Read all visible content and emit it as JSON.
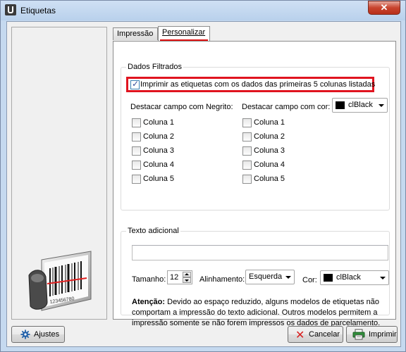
{
  "window": {
    "title": "Etiquetas",
    "close_glyph": "✕"
  },
  "tabs": [
    {
      "label": "Impressão"
    },
    {
      "label": "Personalizar"
    }
  ],
  "filtered": {
    "group_label": "Dados Filtrados",
    "print_checkbox_label": "Imprimir as etiquetas com os dados das primeiras 5 colunas listadas",
    "print_checked": true,
    "bold_heading": "Destacar campo com Negrito:",
    "color_heading": "Destacar campo com cor:",
    "color_value": "clBlack",
    "bold_columns": [
      "Coluna 1",
      "Coluna 2",
      "Coluna 3",
      "Coluna 4",
      "Coluna 5"
    ],
    "color_columns": [
      "Coluna 1",
      "Coluna 2",
      "Coluna 3",
      "Coluna 4",
      "Coluna 5"
    ]
  },
  "extra": {
    "group_label": "Texto adicional",
    "text_value": "",
    "size_label": "Tamanho:",
    "size_value": "12",
    "align_label": "Alinhamento:",
    "align_value": "Esquerda",
    "color_label": "Cor:",
    "color_value": "clBlack",
    "note_bold": "Atenção:",
    "note_text": " Devido ao espaço reduzido, alguns modelos de etiquetas não comportam a impressão do texto adicional. Outros modelos permitem a impressão somente se não forem impressos os dados de parcelamento."
  },
  "buttons": {
    "settings": "Ajustes",
    "cancel": "Cancelar",
    "print": "Imprimir"
  },
  "barcode_text": "123456780",
  "icons": [
    "app-icon",
    "close-icon",
    "barcode-scanner-icon",
    "gear-icon",
    "cancel-x-icon",
    "printer-icon",
    "chevron-down-icon"
  ],
  "colors": {
    "highlight": "#e0141f",
    "swatch": "#000000"
  }
}
